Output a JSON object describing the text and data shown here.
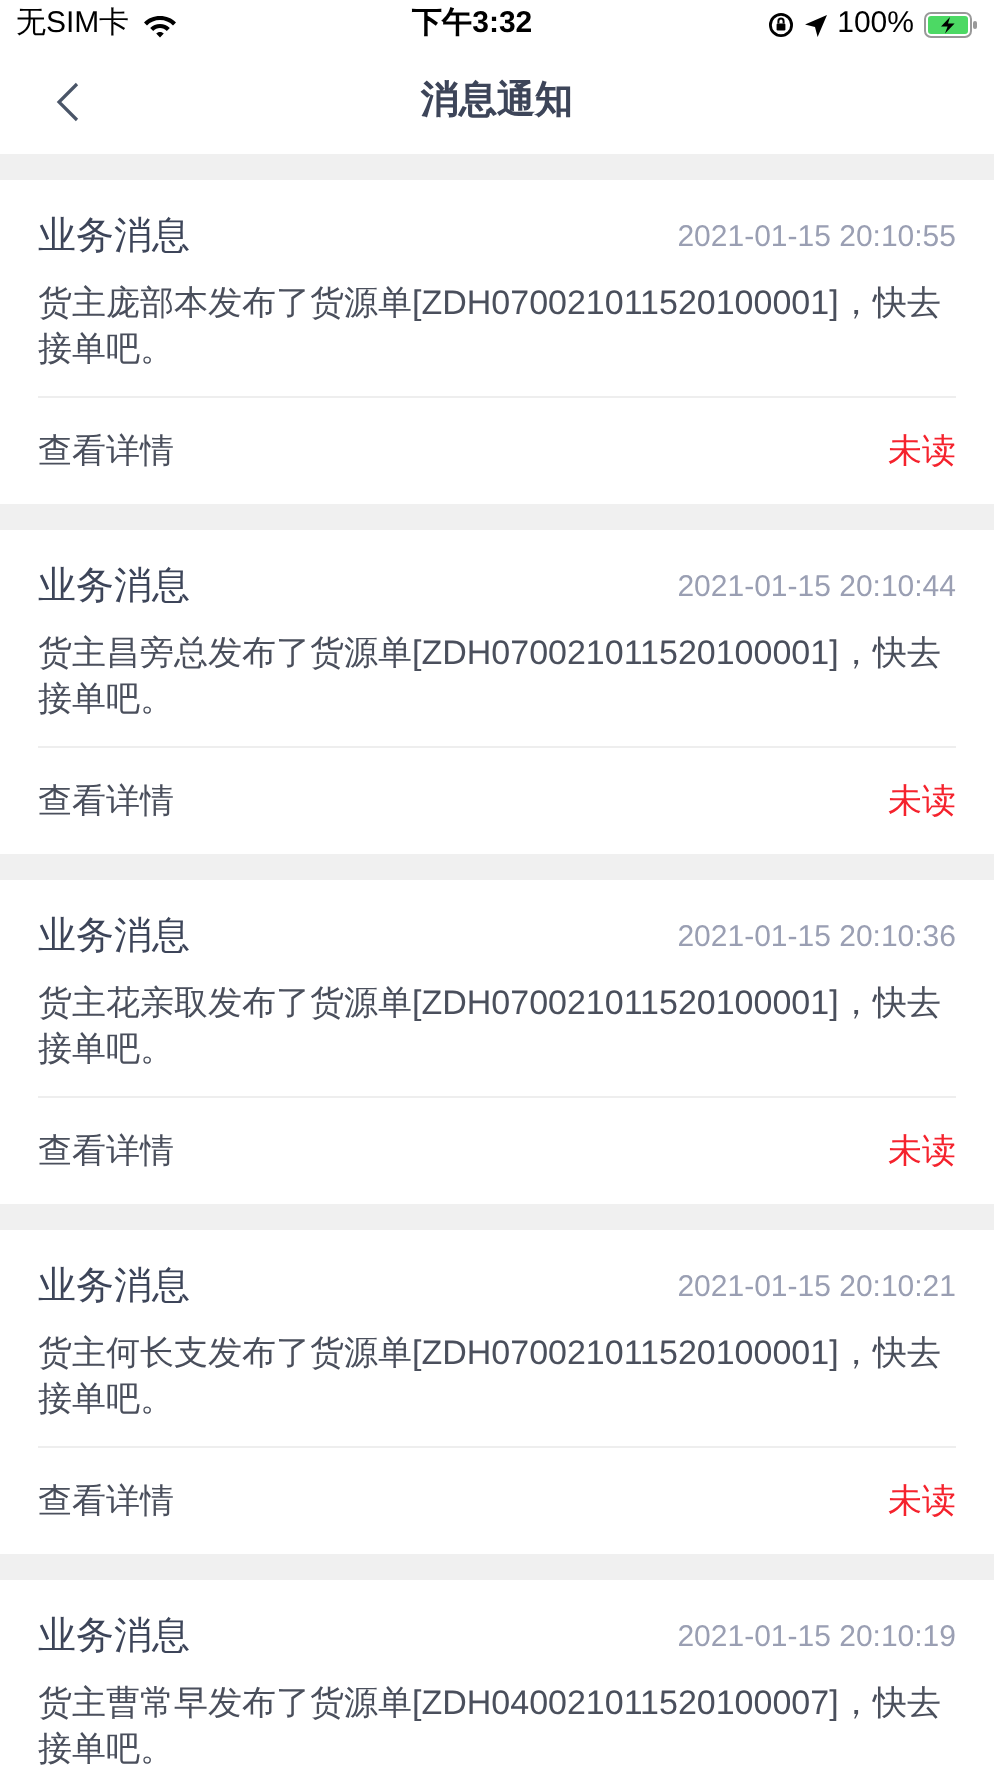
{
  "status_bar": {
    "carrier": "无SIM卡",
    "time": "下午3:32",
    "battery": "100%"
  },
  "nav": {
    "title": "消息通知"
  },
  "messages": [
    {
      "title": "业务消息",
      "time": "2021-01-15 20:10:55",
      "body": "货主庞部本发布了货源单[ZDH070021011520100001]，快去接单吧。",
      "link": "查看详情",
      "status": "未读",
      "unread": true
    },
    {
      "title": "业务消息",
      "time": "2021-01-15 20:10:44",
      "body": "货主昌旁总发布了货源单[ZDH070021011520100001]，快去接单吧。",
      "link": "查看详情",
      "status": "未读",
      "unread": true
    },
    {
      "title": "业务消息",
      "time": "2021-01-15 20:10:36",
      "body": "货主花亲取发布了货源单[ZDH070021011520100001]，快去接单吧。",
      "link": "查看详情",
      "status": "未读",
      "unread": true
    },
    {
      "title": "业务消息",
      "time": "2021-01-15 20:10:21",
      "body": "货主何长支发布了货源单[ZDH070021011520100001]，快去接单吧。",
      "link": "查看详情",
      "status": "未读",
      "unread": true
    },
    {
      "title": "业务消息",
      "time": "2021-01-15 20:10:19",
      "body": "货主曹常早发布了货源单[ZDH040021011520100007]，快去接单吧。"
    }
  ]
}
